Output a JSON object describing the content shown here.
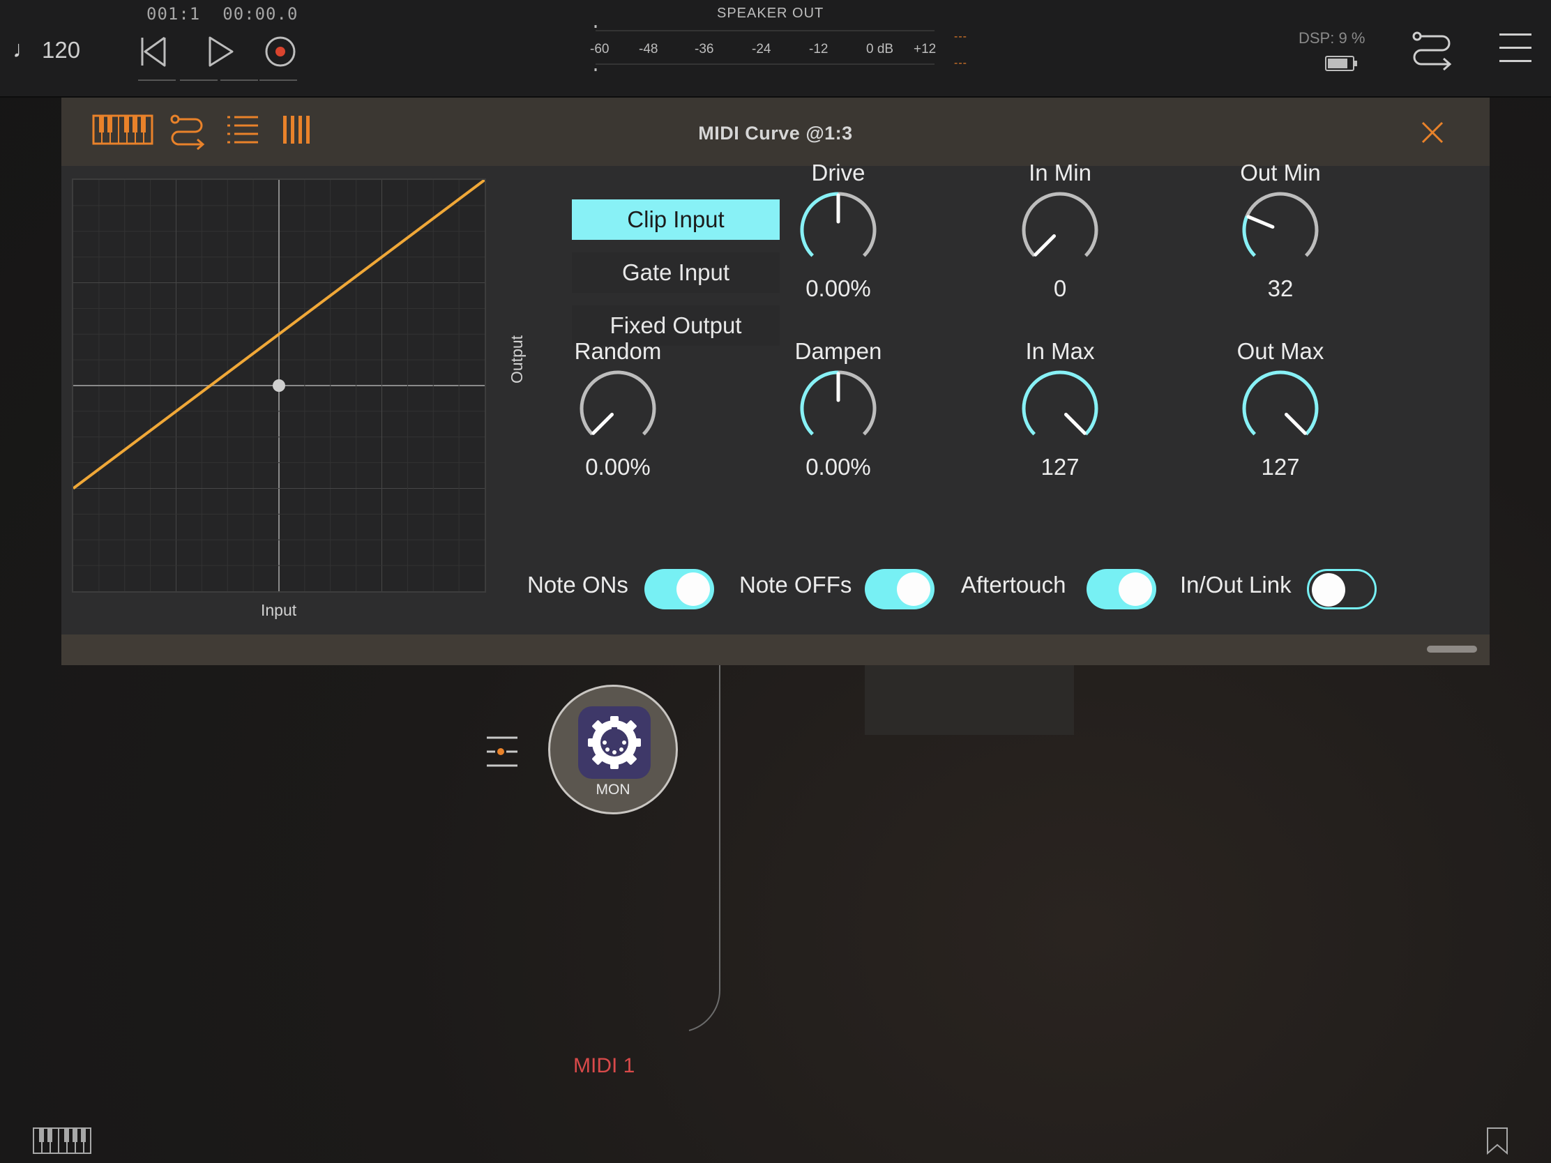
{
  "topbar": {
    "tempo": "120",
    "tempo_icon": "note-icon",
    "position_bars": "001:1",
    "position_time": "00:00.0",
    "transport": [
      "rewind-icon",
      "play-icon",
      "record-icon"
    ],
    "meter_title": "SPEAKER OUT",
    "meter_labels": [
      "-60",
      "-48",
      "-36",
      "-24",
      "-12",
      "0 dB",
      "+12"
    ],
    "meter_peak_top": "---",
    "meter_peak_bottom": "---",
    "dsp_label": "DSP:",
    "dsp_value": "9 %",
    "accent_color": "#e07a2a"
  },
  "panel": {
    "title": "MIDI Curve @1:3",
    "toolbar_icons": [
      "keyboard-icon",
      "routing-icon",
      "list-icon",
      "bars-icon"
    ],
    "graph": {
      "xlabel": "Input",
      "ylabel": "Output",
      "curve_color": "#f0a838"
    },
    "modes": [
      {
        "label": "Clip Input",
        "active": true
      },
      {
        "label": "Gate Input",
        "active": false
      },
      {
        "label": "Fixed Output",
        "active": false
      }
    ],
    "knobs": [
      {
        "label": "Drive",
        "value": "0.00%",
        "level": 0.5,
        "bipolar": true
      },
      {
        "label": "In Min",
        "value": "0",
        "level": 0.0,
        "bipolar": false
      },
      {
        "label": "Out Min",
        "value": "32",
        "level": 0.25,
        "bipolar": false
      },
      {
        "label": "Random",
        "value": "0.00%",
        "level": 0.0,
        "bipolar": false
      },
      {
        "label": "Dampen",
        "value": "0.00%",
        "level": 0.5,
        "bipolar": true
      },
      {
        "label": "In Max",
        "value": "127",
        "level": 1.0,
        "bipolar": false
      },
      {
        "label": "Out Max",
        "value": "127",
        "level": 1.0,
        "bipolar": false
      }
    ],
    "toggles": [
      {
        "label": "Note ONs",
        "on": true
      },
      {
        "label": "Note OFFs",
        "on": true
      },
      {
        "label": "Aftertouch",
        "on": true
      },
      {
        "label": "In/Out Link",
        "on": false
      }
    ],
    "active_color": "#88f1f6"
  },
  "node": {
    "label": "MON",
    "icon": "midi-gear-icon"
  },
  "bus_label": "MIDI 1"
}
